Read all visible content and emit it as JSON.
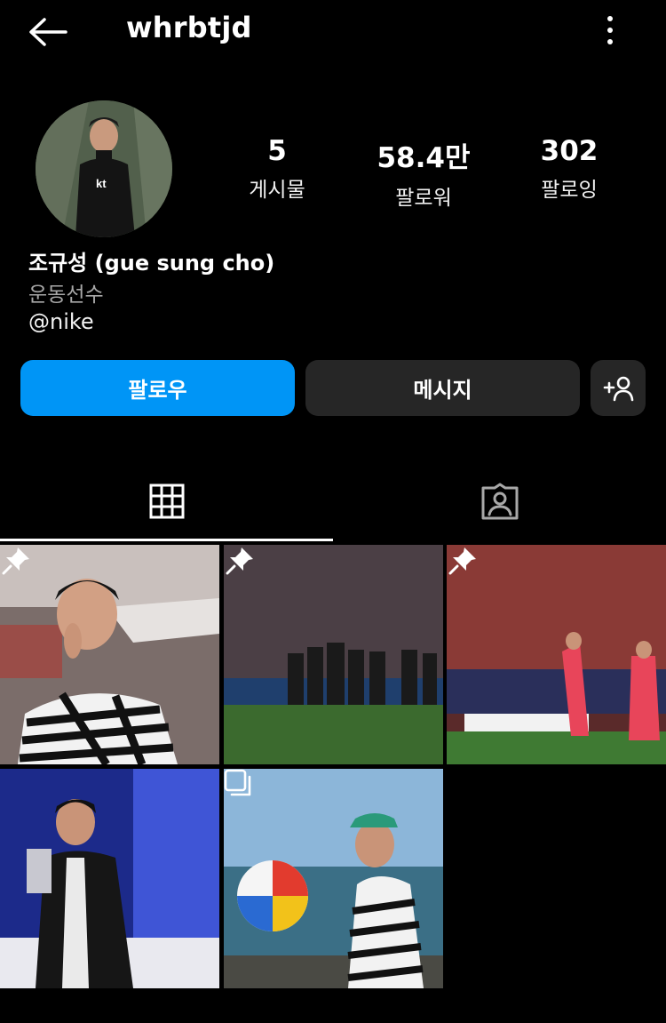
{
  "header": {
    "username": "whrbtjd",
    "back_icon": "arrow-left-icon",
    "more_icon": "more-vertical-icon"
  },
  "profile": {
    "avatar_icon": "profile-photo",
    "full_name": "조규성 (gue sung cho)",
    "category": "운동선수",
    "mention": "@nike"
  },
  "stats": {
    "posts": {
      "value": "5",
      "label": "게시물"
    },
    "followers": {
      "value": "58.4만",
      "label": "팔로워"
    },
    "following": {
      "value": "302",
      "label": "팔로잉"
    }
  },
  "actions": {
    "follow_label": "팔로우",
    "message_label": "메시지",
    "add_user_icon": "add-person-icon"
  },
  "tabs": [
    {
      "icon": "grid-icon",
      "active": true
    },
    {
      "icon": "tagged-icon",
      "active": false
    }
  ],
  "posts": [
    {
      "pinned": true,
      "type": "photo"
    },
    {
      "pinned": true,
      "type": "photo"
    },
    {
      "pinned": true,
      "type": "photo"
    },
    {
      "pinned": false,
      "type": "photo"
    },
    {
      "pinned": false,
      "type": "carousel"
    }
  ],
  "colors": {
    "background": "#000000",
    "follow_button": "#0095f6",
    "secondary_button": "#262626",
    "muted_text": "#a8a8a8"
  }
}
